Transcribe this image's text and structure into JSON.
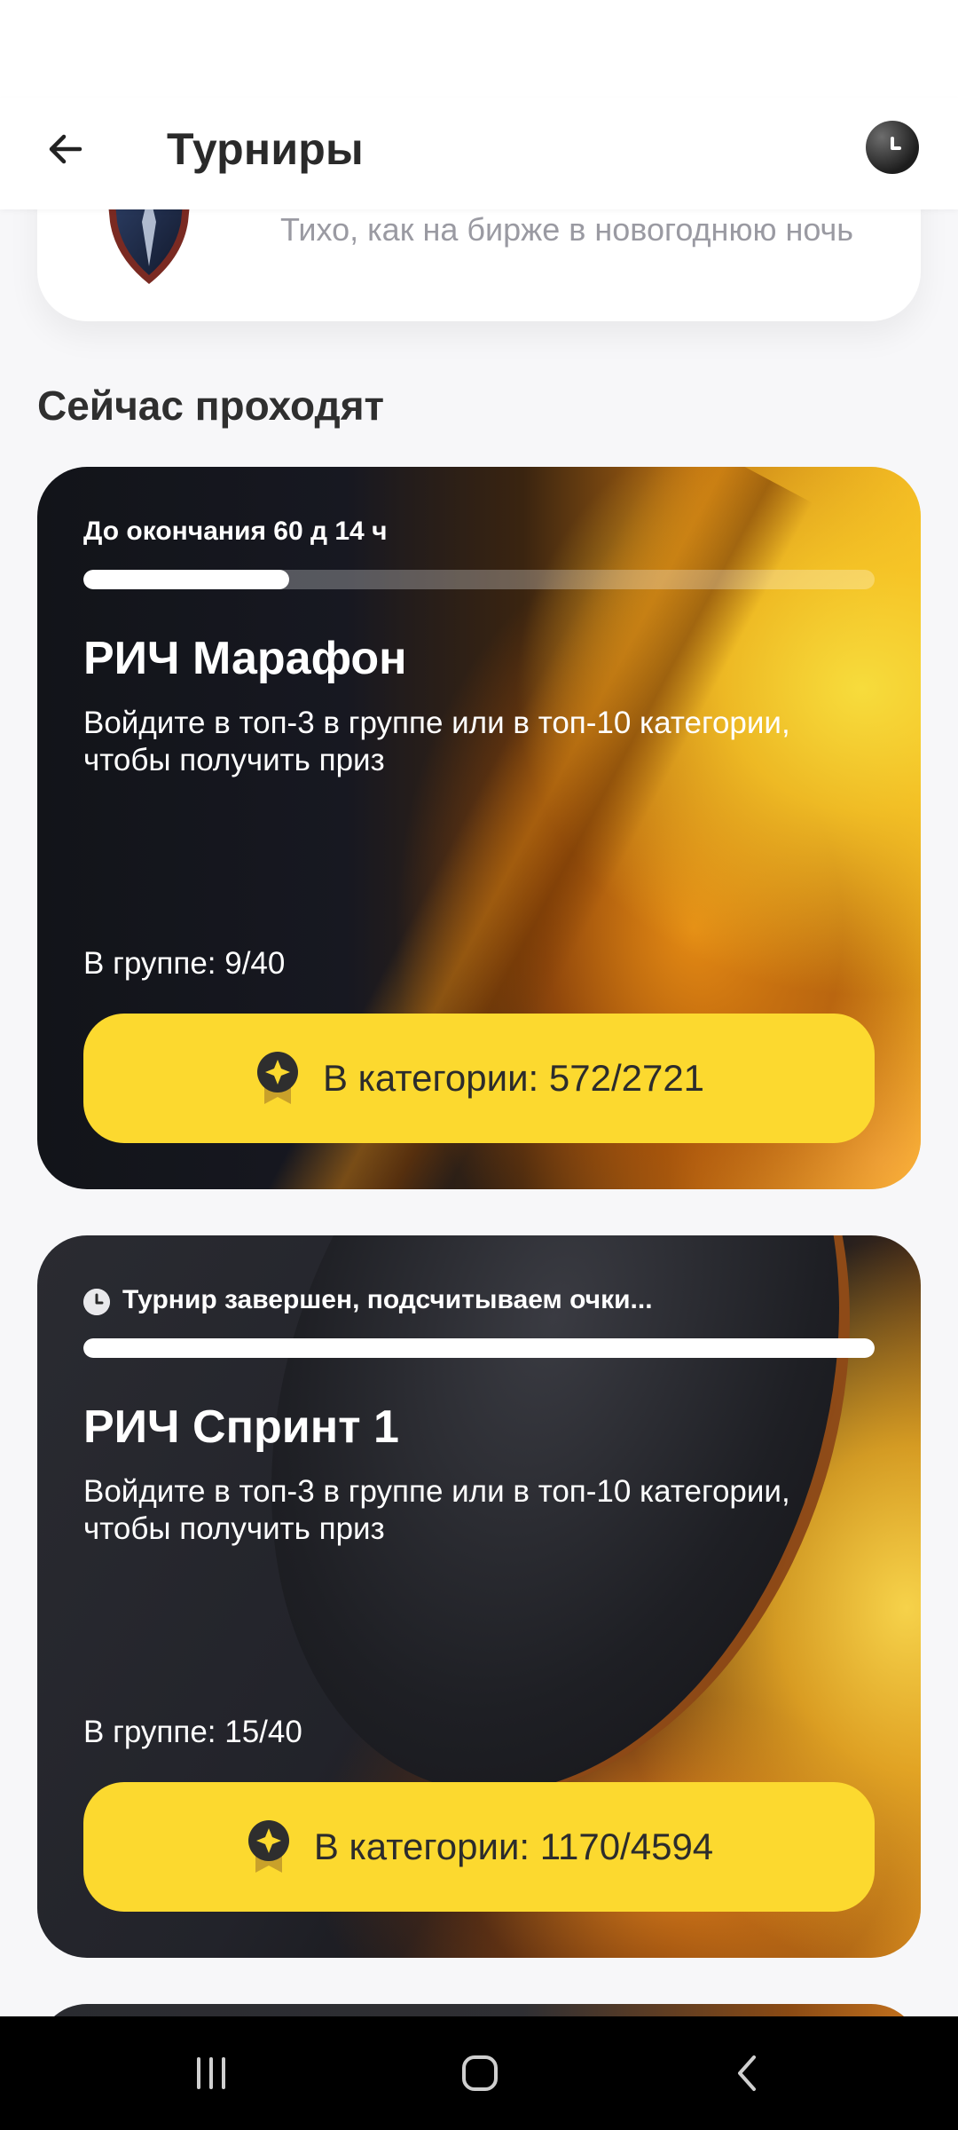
{
  "app_bar": {
    "title": "Турниры",
    "back_icon": "arrow-left-icon",
    "history_icon": "clock-icon"
  },
  "league": {
    "status_text": "Тихо, как на бирже в новогоднюю ночь",
    "emblem_icon": "shield-emblem-icon"
  },
  "section": {
    "title": "Сейчас проходят"
  },
  "tournaments": [
    {
      "timer_text": "До окончания 60 д 14 ч",
      "progress_fraction": 0.26,
      "title": "РИЧ Марафон",
      "description": "Войдите в топ-3 в группе или в топ-10 категории, чтобы получить приз",
      "group_text": "В группе: 9/40",
      "category_text": "В категории: 572/2721",
      "badge_icon": "star-badge-icon"
    },
    {
      "timer_text": "Турнир завершен, подсчитываем очки...",
      "progress_fraction": 1.0,
      "title": "РИЧ Спринт 1",
      "description": "Войдите в топ-3 в группе или в топ-10 категории, чтобы получить приз",
      "group_text": "В группе: 15/40",
      "category_text": "В категории: 1170/4594",
      "badge_icon": "star-badge-icon",
      "status_icon": "clock-icon"
    }
  ],
  "colors": {
    "accent_yellow": "#fcd92f",
    "card_dark": "#141519",
    "text_muted": "#9a9aa2"
  },
  "nav_bar": {
    "recent_icon": "recent-apps-icon",
    "home_icon": "home-icon",
    "back_icon": "back-chevron-icon"
  }
}
